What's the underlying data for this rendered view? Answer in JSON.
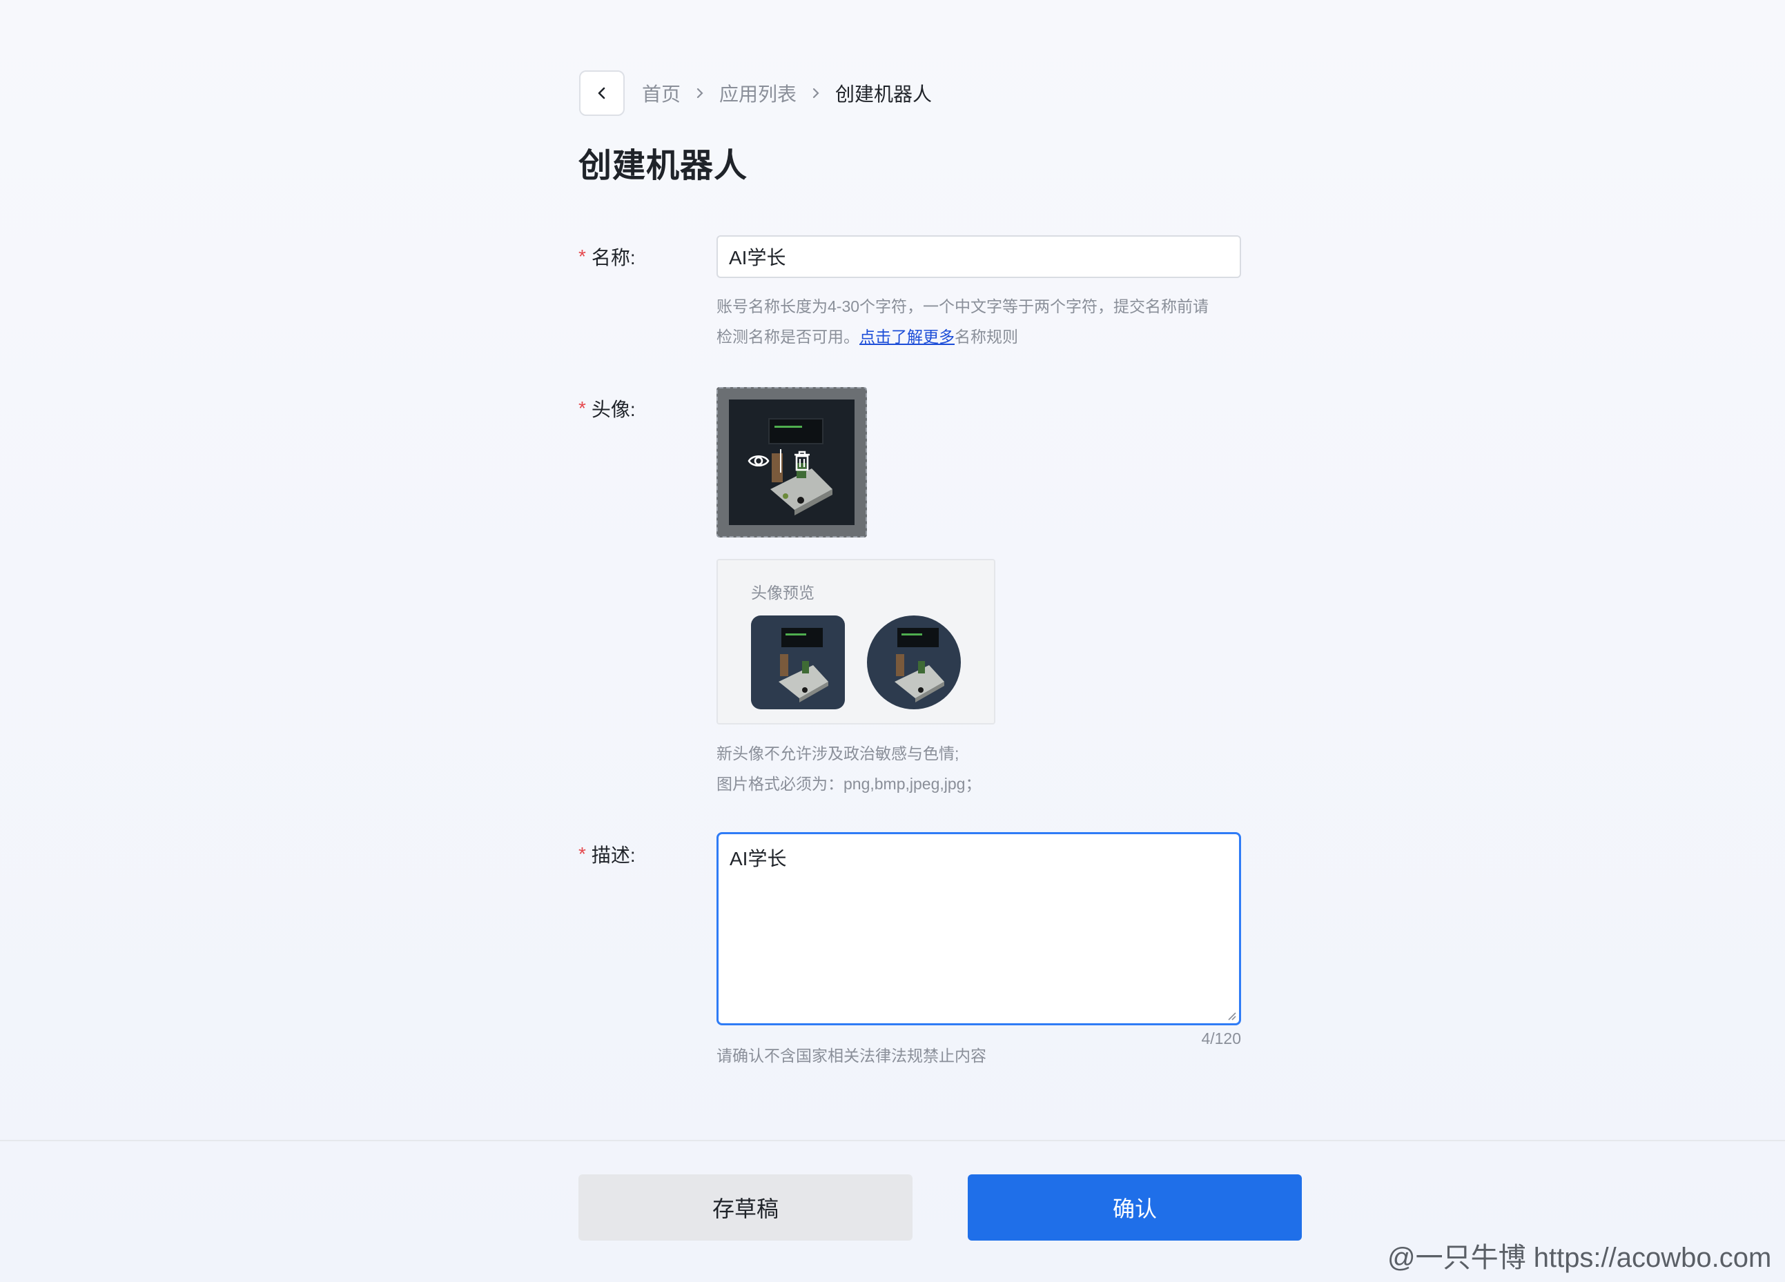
{
  "breadcrumb": {
    "items": [
      "首页",
      "应用列表",
      "创建机器人"
    ]
  },
  "page": {
    "title": "创建机器人"
  },
  "form": {
    "required_mark": "*",
    "name": {
      "label": "名称:",
      "value": "AI学长",
      "hint_line1": "账号名称长度为4-30个字符，一个中文字等于两个字符，提交名称前请",
      "hint_line2_prefix": "检测名称是否可用。",
      "hint_link": "点击了解更多",
      "hint_line2_suffix": "名称规则"
    },
    "avatar": {
      "label": "头像:",
      "preview_title": "头像预览",
      "hint_line1": "新头像不允许涉及政治敏感与色情;",
      "hint_line2": "图片格式必须为：png,bmp,jpeg,jpg；",
      "actions": [
        "eye-icon",
        "trash-icon"
      ]
    },
    "description": {
      "label": "描述:",
      "value": "AI学长",
      "count": "4/120",
      "hint": "请确认不含国家相关法律法规禁止内容"
    }
  },
  "footer": {
    "draft_label": "存草稿",
    "confirm_label": "确认"
  },
  "watermark": "@一只牛博 https://acowbo.com",
  "colors": {
    "accent": "#1f6fe9",
    "required": "#e5484d",
    "focus_border": "#2f7cf6"
  }
}
